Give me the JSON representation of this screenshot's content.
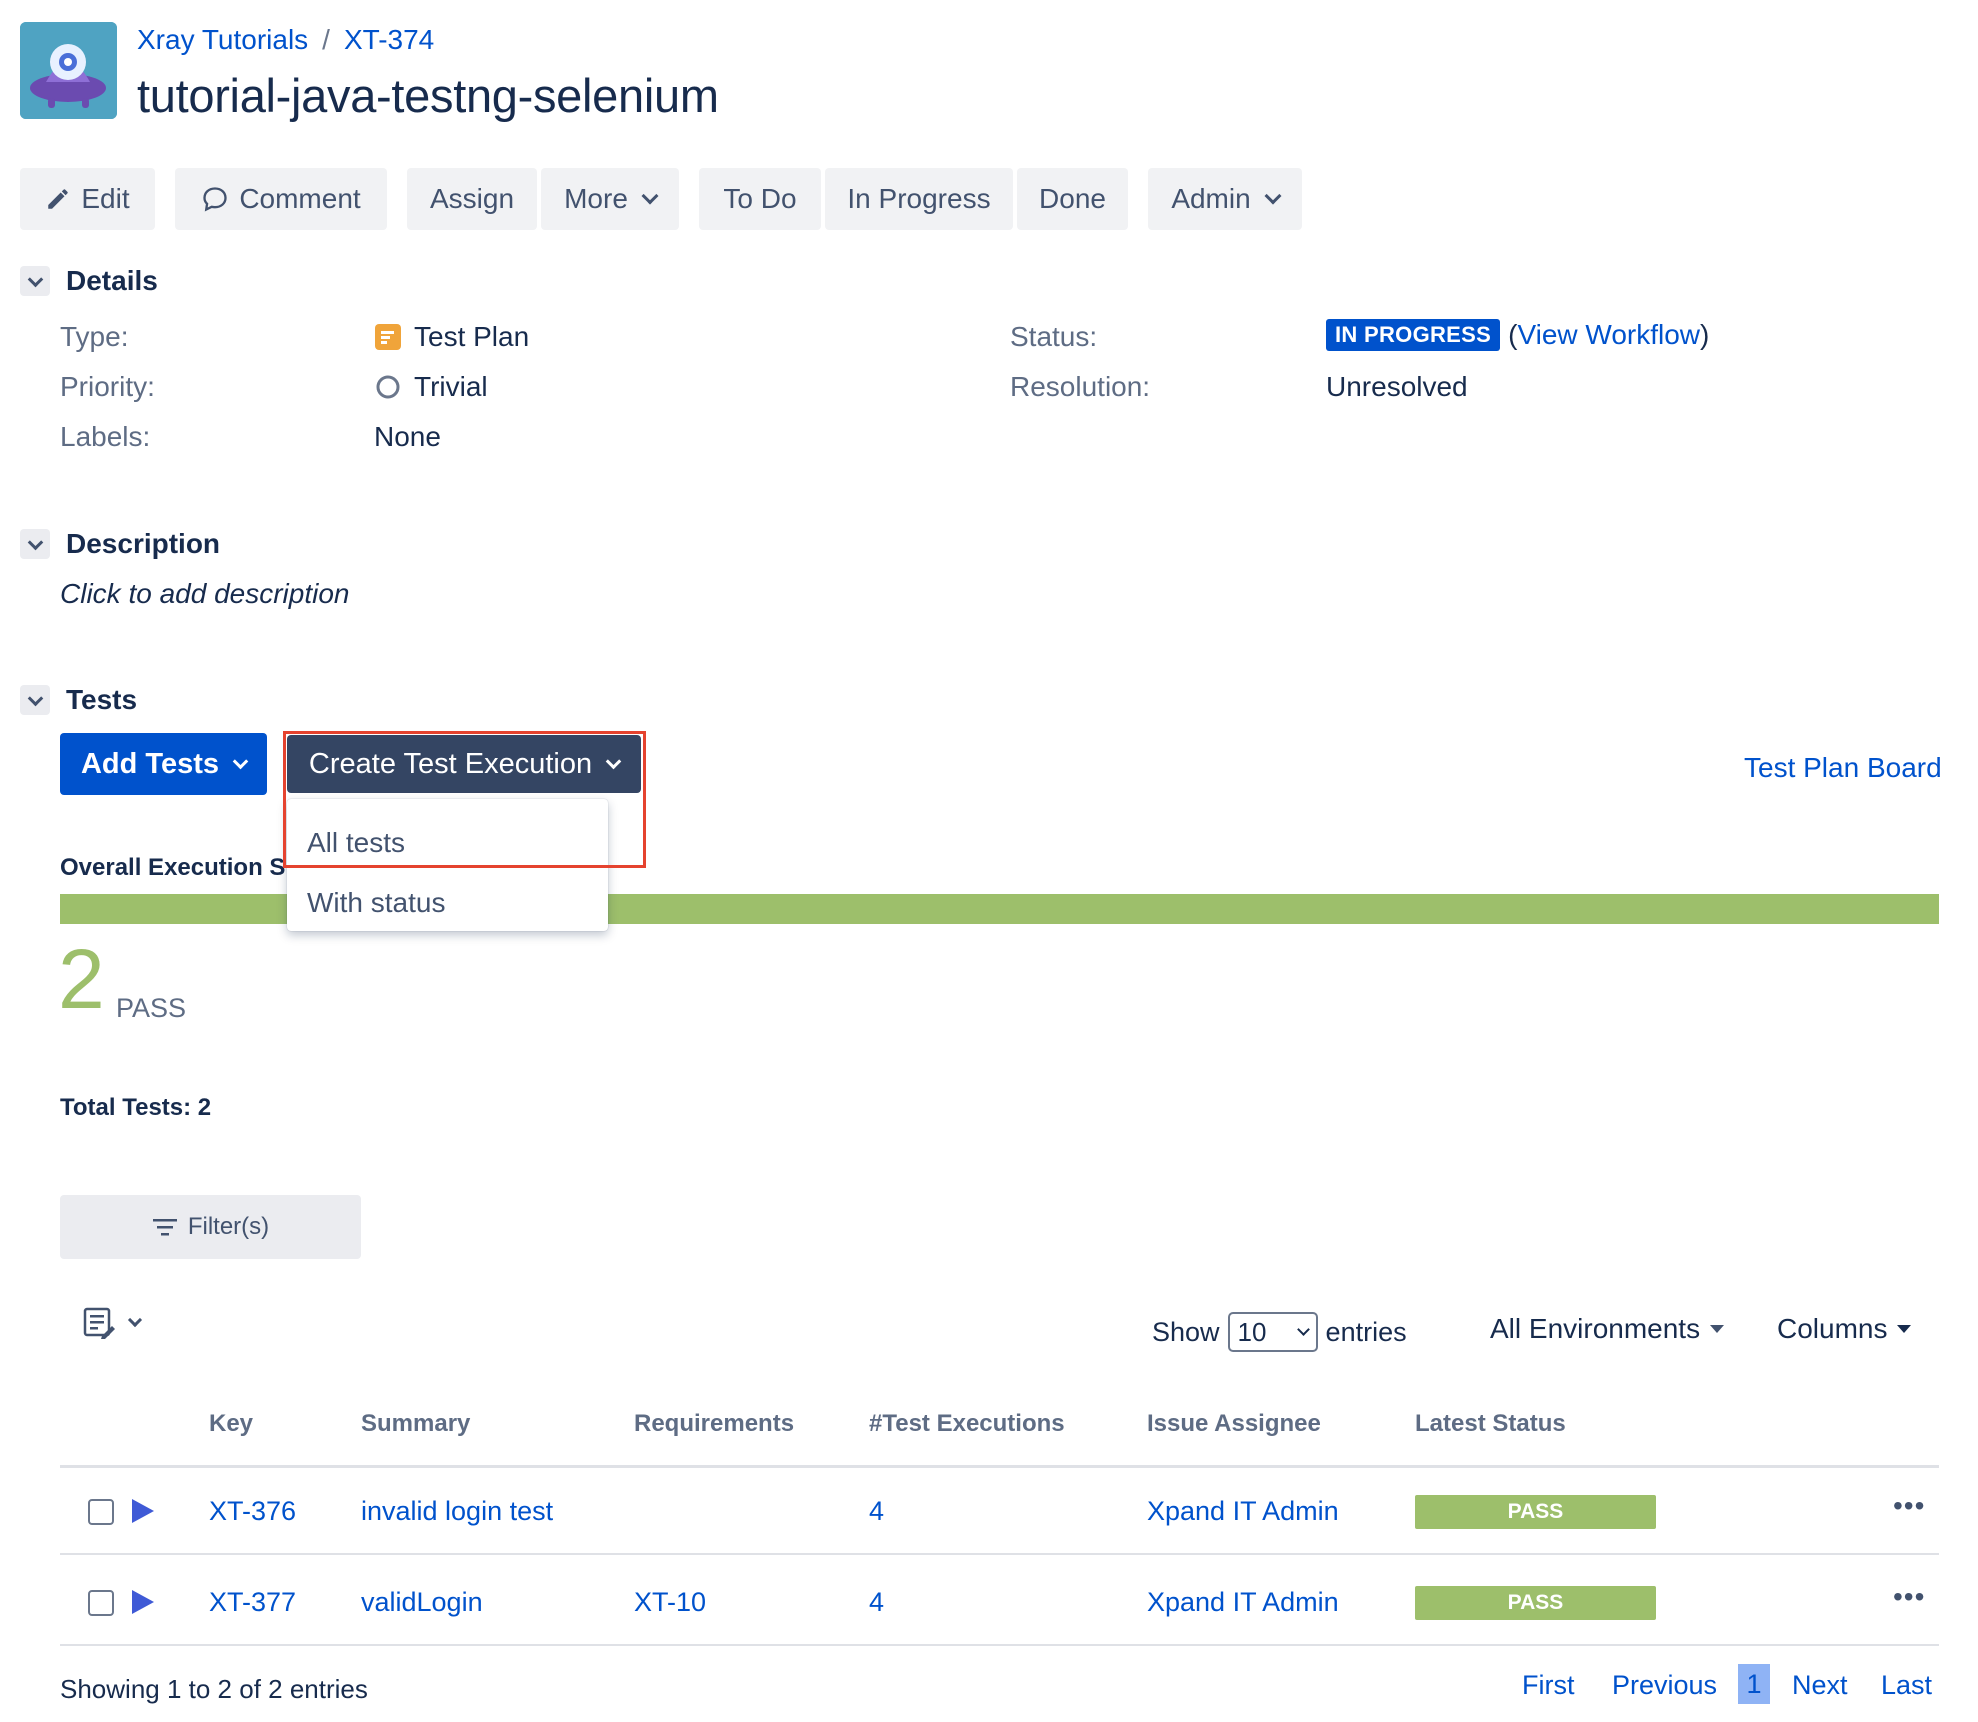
{
  "breadcrumb": {
    "project": "Xray Tutorials",
    "separator": "/",
    "issue_key": "XT-374"
  },
  "issue": {
    "title": "tutorial-java-testng-selenium"
  },
  "toolbar": {
    "edit": "Edit",
    "comment": "Comment",
    "assign": "Assign",
    "more": "More",
    "todo": "To Do",
    "in_progress": "In Progress",
    "done": "Done",
    "admin": "Admin"
  },
  "details": {
    "heading": "Details",
    "type_label": "Type:",
    "type_value": "Test Plan",
    "priority_label": "Priority:",
    "priority_value": "Trivial",
    "labels_label": "Labels:",
    "labels_value": "None",
    "status_label": "Status:",
    "status_value": "IN PROGRESS",
    "view_workflow_open": "(",
    "view_workflow": "View Workflow",
    "view_workflow_close": ")",
    "resolution_label": "Resolution:",
    "resolution_value": "Unresolved"
  },
  "description": {
    "heading": "Description",
    "placeholder": "Click to add description"
  },
  "tests": {
    "heading": "Tests",
    "add_tests": "Add Tests",
    "create_execution": "Create Test Execution",
    "board_link": "Test Plan Board",
    "dropdown": [
      "All tests",
      "With status"
    ],
    "overall_label": "Overall Execution S",
    "pass_count": "2",
    "pass_label": "PASS",
    "pass_fraction": 1.0,
    "total": "Total Tests: 2",
    "filter": "Filter(s)"
  },
  "table_controls": {
    "show": "Show",
    "entries_value": "10",
    "entries": "entries",
    "environments": "All Environments",
    "columns": "Columns"
  },
  "table": {
    "headers": [
      "Key",
      "Summary",
      "Requirements",
      "#Test Executions",
      "Issue Assignee",
      "Latest Status"
    ],
    "rows": [
      {
        "key": "XT-376",
        "summary": "invalid login test",
        "requirements": "",
        "executions": "4",
        "assignee": "Xpand IT Admin",
        "status": "PASS"
      },
      {
        "key": "XT-377",
        "summary": "validLogin",
        "requirements": "XT-10",
        "executions": "4",
        "assignee": "Xpand IT Admin",
        "status": "PASS"
      }
    ]
  },
  "footer": {
    "showing": "Showing 1 to 2 of 2 entries",
    "first": "First",
    "previous": "Previous",
    "page": "1",
    "next": "Next",
    "last": "Last"
  },
  "colors": {
    "accent": "#0052cc",
    "pass": "#9dbf6b",
    "dark_button": "#344563",
    "highlight": "#e5432f"
  }
}
